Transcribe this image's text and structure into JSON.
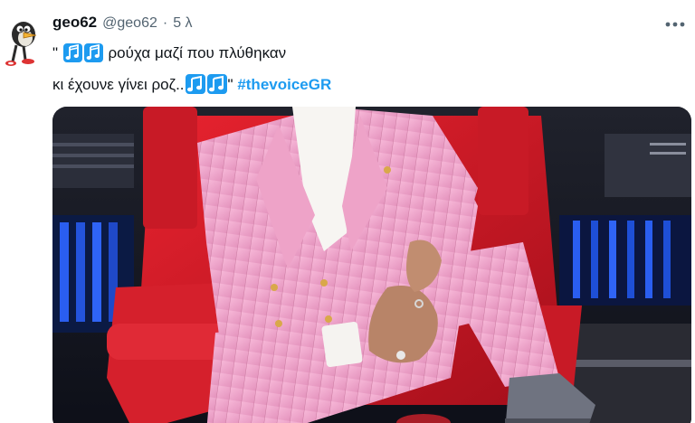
{
  "tweet": {
    "author": {
      "display_name": "geo62",
      "handle": "@geo62",
      "avatar_icon": "cartoon-bird-avatar-icon"
    },
    "separator": "·",
    "time": "5 λ",
    "more_icon": "more-options-icon",
    "text": {
      "open_quote": "\"",
      "line1_text": "ρούχα μαζί που πλύθηκαν",
      "line2_text": "κι έχουνε γίνει ροζ..",
      "close_quote": "\"",
      "hashtag": "#thevoiceGR",
      "note_icon_double": "beamed-sixteenth-notes-icon",
      "note_icon_single": "beamed-eighth-notes-icon"
    },
    "media": {
      "kind": "photo",
      "subject_colors": {
        "suit": "#f2a9cf",
        "chair": "#d4192a",
        "stage_lights": "#1e4fd6"
      }
    }
  },
  "colors": {
    "hashtag": "#1d9bf0",
    "secondary_text": "#536471",
    "note_blue": "#1d9bf0"
  }
}
